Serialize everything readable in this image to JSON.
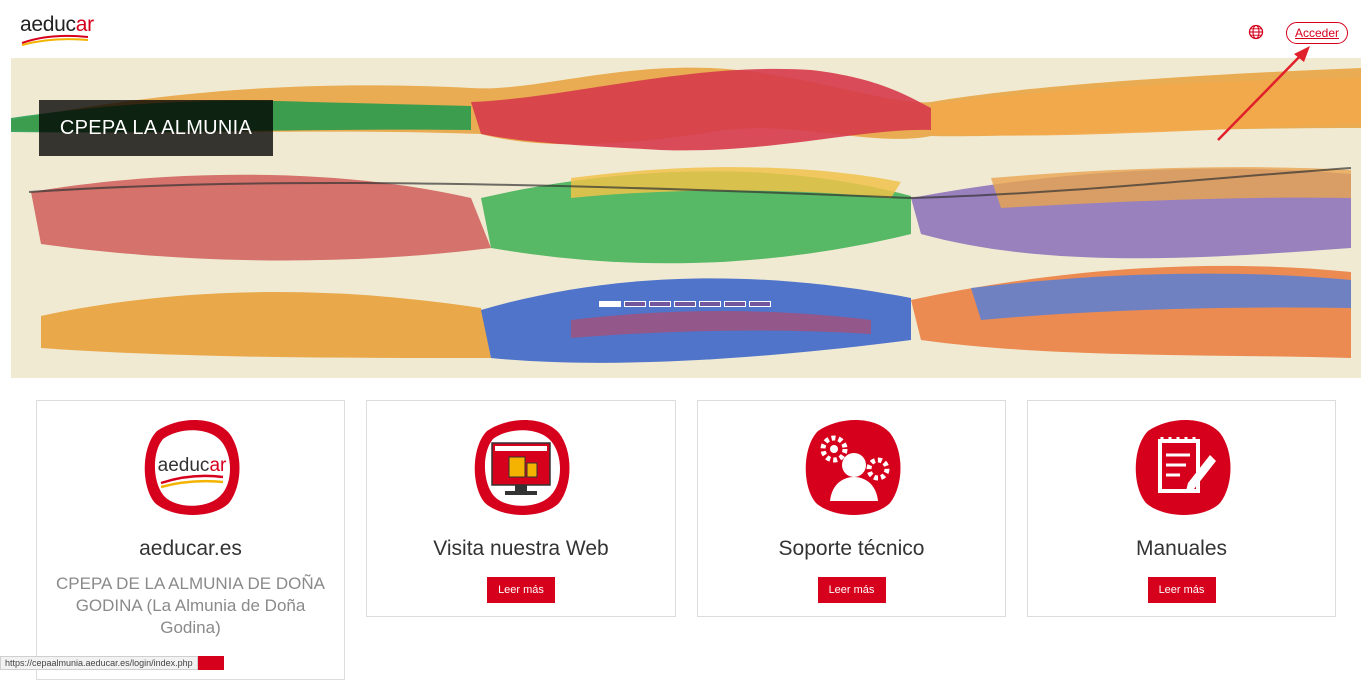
{
  "header": {
    "logo_prefix": "aeduc",
    "logo_suffix": "ar",
    "login_label": "Acceder",
    "language_icon": "globe-icon"
  },
  "banner": {
    "title": "CPEPA LA ALMUNIA",
    "slide_count": 7,
    "active_slide": 1
  },
  "cards": [
    {
      "title": "aeducar.es",
      "description": "CPEPA DE LA ALMUNIA DE DOÑA GODINA (La Almunia de Doña Godina)",
      "icon": "aeducar-logo-icon",
      "button_label": ""
    },
    {
      "title": "Visita nuestra Web",
      "icon": "website-monitor-icon",
      "button_label": "Leer más"
    },
    {
      "title": "Soporte técnico",
      "icon": "support-gears-user-icon",
      "button_label": "Leer más"
    },
    {
      "title": "Manuales",
      "icon": "notebook-pencil-icon",
      "button_label": "Leer más"
    }
  ],
  "status_bar": {
    "url": "https://cepaalmunia.aeducar.es/login/index.php"
  },
  "colors": {
    "accent": "#d6001c",
    "title_bg": "#000000"
  }
}
